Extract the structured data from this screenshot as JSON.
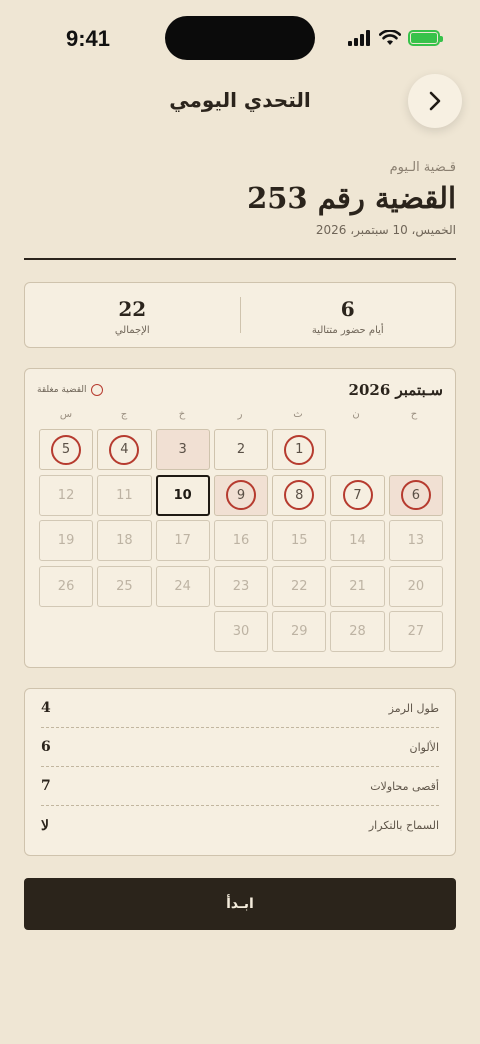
{
  "status_bar": {
    "time": "9:41"
  },
  "header": {
    "title": "التحدي اليومي",
    "forward_icon": "chevron-right-icon"
  },
  "case": {
    "label": "قـضية الـيوم",
    "title": "القضية رقم 253",
    "date": "الخميس، 10 سبتمبر، 2026"
  },
  "stats": [
    {
      "value": "6",
      "label": "أيام حضور متتالية"
    },
    {
      "value": "22",
      "label": "الإجمالي"
    }
  ],
  "calendar": {
    "month": "سـبتمبر 2026",
    "legend": "القضية مغلقة",
    "weekdays": [
      "ح",
      "ن",
      "ث",
      "ر",
      "خ",
      "ج",
      "س"
    ],
    "weeks": [
      [
        {
          "day": ""
        },
        {
          "day": ""
        },
        {
          "day": "1",
          "state": "past",
          "solved": true
        },
        {
          "day": "2",
          "state": "past"
        },
        {
          "day": "3",
          "state": "past",
          "tinted": true
        },
        {
          "day": "4",
          "state": "past",
          "solved": true
        },
        {
          "day": "5",
          "state": "past",
          "solved": true
        }
      ],
      [
        {
          "day": "6",
          "state": "past",
          "solved": true,
          "tinted": true
        },
        {
          "day": "7",
          "state": "past",
          "solved": true
        },
        {
          "day": "8",
          "state": "past",
          "solved": true
        },
        {
          "day": "9",
          "state": "past",
          "solved": true,
          "tinted": true
        },
        {
          "day": "10",
          "state": "today"
        },
        {
          "day": "11"
        },
        {
          "day": "12"
        }
      ],
      [
        {
          "day": "13"
        },
        {
          "day": "14"
        },
        {
          "day": "15"
        },
        {
          "day": "16"
        },
        {
          "day": "17"
        },
        {
          "day": "18"
        },
        {
          "day": "19"
        }
      ],
      [
        {
          "day": "20"
        },
        {
          "day": "21"
        },
        {
          "day": "22"
        },
        {
          "day": "23"
        },
        {
          "day": "24"
        },
        {
          "day": "25"
        },
        {
          "day": "26"
        }
      ],
      [
        {
          "day": "27"
        },
        {
          "day": "28"
        },
        {
          "day": "29"
        },
        {
          "day": "30"
        },
        {
          "day": ""
        },
        {
          "day": ""
        },
        {
          "day": ""
        }
      ]
    ]
  },
  "rules": [
    {
      "label": "طول الرمز",
      "value": "4"
    },
    {
      "label": "الألوان",
      "value": "6"
    },
    {
      "label": "أقصى محاولات",
      "value": "7"
    },
    {
      "label": "السماح بالتكرار",
      "value": "لا"
    }
  ],
  "start_button": {
    "label": "ابـدأ"
  },
  "colors": {
    "background": "#efe6d4",
    "accent_red": "#b63b2f",
    "dark": "#2b241b"
  }
}
